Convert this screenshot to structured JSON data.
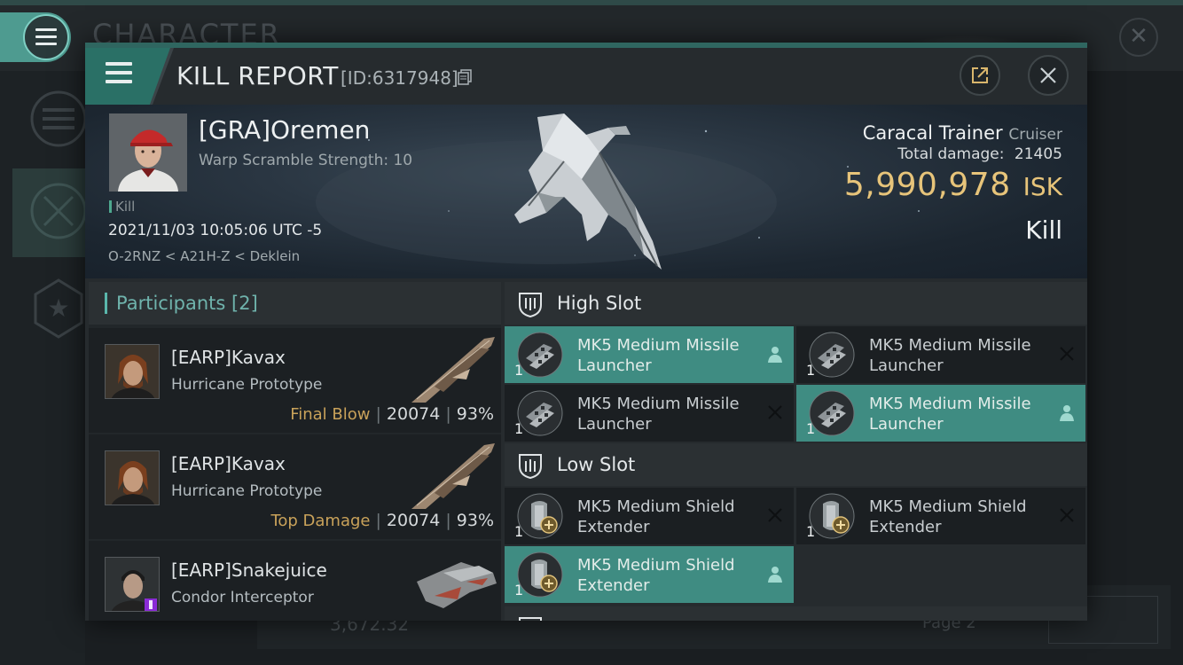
{
  "background": {
    "title": "CHARACTER",
    "bottom_value": "3,672.32",
    "page_label": "Page 2"
  },
  "kill_report": {
    "title": "KILL REPORT",
    "id_label": "[ID:6317948]",
    "victim": {
      "name": "[GRA]Oremen",
      "subtitle": "Warp Scramble Strength: 10",
      "kill_tag": "Kill",
      "datetime": "2021/11/03 10:05:06 UTC -5",
      "location": "O-2RNZ < A21H-Z < Deklein"
    },
    "ship": {
      "name": "Caracal Trainer",
      "class": "Cruiser",
      "total_damage_label": "Total damage:",
      "total_damage": "21405",
      "isk_value": "5,990,978",
      "isk_unit": "ISK",
      "result": "Kill"
    },
    "participants": {
      "label": "Participants",
      "count": "[2]",
      "rows": [
        {
          "name": "[EARP]Kavax",
          "ship": "Hurricane Prototype",
          "tag": "Final Blow",
          "damage": "20074",
          "percent": "93%"
        },
        {
          "name": "[EARP]Kavax",
          "ship": "Hurricane Prototype",
          "tag": "Top Damage",
          "damage": "20074",
          "percent": "93%"
        },
        {
          "name": "[EARP]Snakejuice",
          "ship": "Condor Interceptor",
          "tag": "",
          "damage": "",
          "percent": ""
        }
      ]
    },
    "fitting": {
      "high_slot": {
        "label": "High Slot",
        "items": [
          {
            "qty": "1",
            "name": "MK5 Medium Missile Launcher",
            "state": "dropped"
          },
          {
            "qty": "1",
            "name": "MK5 Medium Missile Launcher",
            "state": "destroyed"
          },
          {
            "qty": "1",
            "name": "MK5 Medium Missile Launcher",
            "state": "destroyed"
          },
          {
            "qty": "1",
            "name": "MK5 Medium Missile Launcher",
            "state": "dropped"
          }
        ]
      },
      "low_slot": {
        "label": "Low Slot",
        "items": [
          {
            "qty": "1",
            "name": "MK5 Medium Shield Extender",
            "state": "destroyed"
          },
          {
            "qty": "1",
            "name": "MK5 Medium Shield Extender",
            "state": "destroyed"
          },
          {
            "qty": "1",
            "name": "MK5 Medium Shield Extender",
            "state": "dropped"
          }
        ]
      }
    }
  },
  "colors": {
    "accent_teal": "#3f8c82",
    "isk_gold": "#e7c47a",
    "tag_gold": "#c9a25a"
  }
}
